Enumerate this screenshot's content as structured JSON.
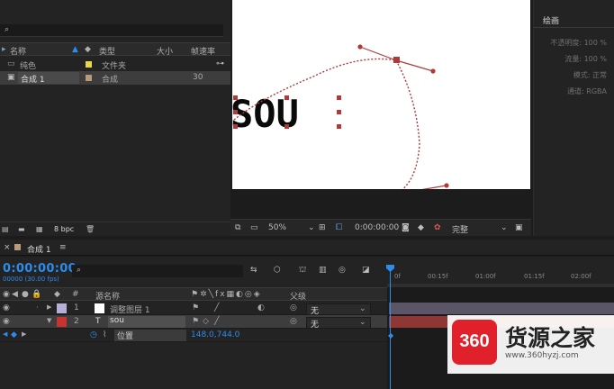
{
  "project": {
    "search_icon": "⌕",
    "columns": {
      "name": "名称",
      "type": "类型",
      "size": "大小",
      "fps": "帧速率"
    },
    "rows": [
      {
        "name": "纯色",
        "type": "文件夹",
        "fps": "",
        "swatch": "#e8d44d"
      },
      {
        "name": "合成 1",
        "type": "合成",
        "fps": "30",
        "swatch": "#b89a78"
      }
    ],
    "footer": {
      "bpc": "8 bpc"
    }
  },
  "viewer": {
    "canvas_text": "SOU",
    "toolbar": {
      "zoom": "50%",
      "timecode": "0:00:00:00",
      "quality": "完整"
    }
  },
  "paint_panel": {
    "title": "绘画",
    "props": [
      {
        "label": "不透明度:",
        "value": "100 %"
      },
      {
        "label": "流量:",
        "value": "100 %"
      },
      {
        "label": "模式:",
        "value": "正常"
      },
      {
        "label": "通道:",
        "value": "RGBA"
      }
    ]
  },
  "timeline": {
    "tab": "合成 1",
    "timecode": "0:00:00:00",
    "fps_sub": "00000 (30.00 fps)",
    "search_icon": "⌕",
    "columns": {
      "num": "#",
      "source": "源名称",
      "parent": "父级"
    },
    "layers": [
      {
        "num": "1",
        "name": "调整图层 1",
        "parent": "无",
        "color": "#b6aed6"
      },
      {
        "num": "2",
        "type": "T",
        "name": "sou",
        "parent": "无",
        "color": "#c9332f"
      }
    ],
    "property": {
      "name": "位置",
      "value": "148.0,744.0"
    },
    "ruler": [
      "0f",
      "00:15f",
      "01:00f",
      "01:15f",
      "02:00f"
    ]
  },
  "watermark": {
    "logo": "360",
    "name": "货源之家",
    "url": "www.360hyzj.com"
  },
  "colors": {
    "accent": "#2d8ceb",
    "path": "#b03a3a",
    "watermark_red": "#e0202a"
  }
}
